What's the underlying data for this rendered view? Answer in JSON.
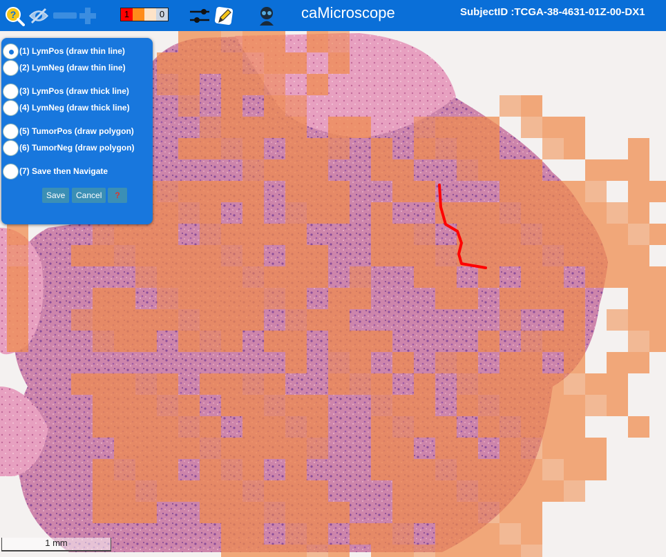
{
  "toolbar": {
    "icons": [
      "help-zoom-icon",
      "visibility-toggle-icon",
      "zoom-slider-icon",
      "zoom-plus-icon",
      "sliders-icon",
      "pencil-draw-icon",
      "user-icon"
    ],
    "scale": {
      "low": "1",
      "high": "0"
    },
    "app_title": "caMicroscope",
    "subject": "SubjectID :TCGA-38-4631-01Z-00-DX1"
  },
  "panel": {
    "options": [
      {
        "label": "(1) LymPos (draw thin line)",
        "selected": true
      },
      {
        "label": "(2) LymNeg (draw thin line)",
        "selected": false
      },
      {
        "label": "(3) LymPos (draw thick line)",
        "selected": false
      },
      {
        "label": "(4) LymNeg (draw thick line)",
        "selected": false
      },
      {
        "label": "(5) TumorPos (draw polygon)",
        "selected": false
      },
      {
        "label": "(6) TumorNeg (draw polygon)",
        "selected": false
      },
      {
        "label": "(7) Save then Navigate",
        "selected": false
      }
    ],
    "save": "Save",
    "cancel": "Cancel",
    "help": "?"
  },
  "scalebar": {
    "label": "1 mm"
  },
  "colors": {
    "toolbar": "#0a6fd8",
    "tissue": "#cf86ac",
    "heatmap": "#f08a4b",
    "annotation": "#ff0000"
  }
}
